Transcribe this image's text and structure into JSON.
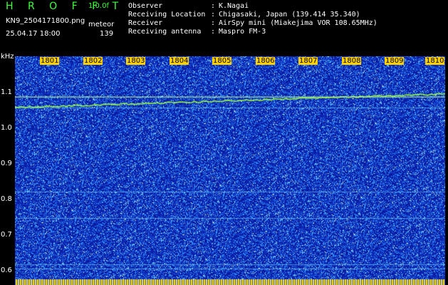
{
  "app": {
    "title": "H R O F F T",
    "version": "1.0.0f"
  },
  "file": {
    "name": "KN9_2504171800.png",
    "datetime": "25.04.17 18:00"
  },
  "meteor": {
    "label": "meteor",
    "count": "139"
  },
  "info": [
    {
      "label": "Observer",
      "value": "K.Nagai"
    },
    {
      "label": "Receiving Location",
      "value": "Chigasaki, Japan (139.414 35.340)"
    },
    {
      "label": "Receiver",
      "value": "AirSpy mini (Miakejima VOR 108.65MHz)"
    },
    {
      "label": "Receiving antenna",
      "value": "Maspro FM-3"
    }
  ],
  "separator": ":",
  "axis": {
    "y_unit": "kHz",
    "y_ticks": [
      "1.1",
      "1.0",
      "0.9",
      "0.8",
      "0.7",
      "0.6"
    ],
    "x_ticks": [
      "1801",
      "1802",
      "1803",
      "1804",
      "1805",
      "1806",
      "1807",
      "1808",
      "1809",
      "1810"
    ]
  },
  "colors": {
    "background": "#0a1aa0",
    "noise": "#39a9ff",
    "signal": "#9cff3c",
    "tick_bg": "#ffd000"
  }
}
